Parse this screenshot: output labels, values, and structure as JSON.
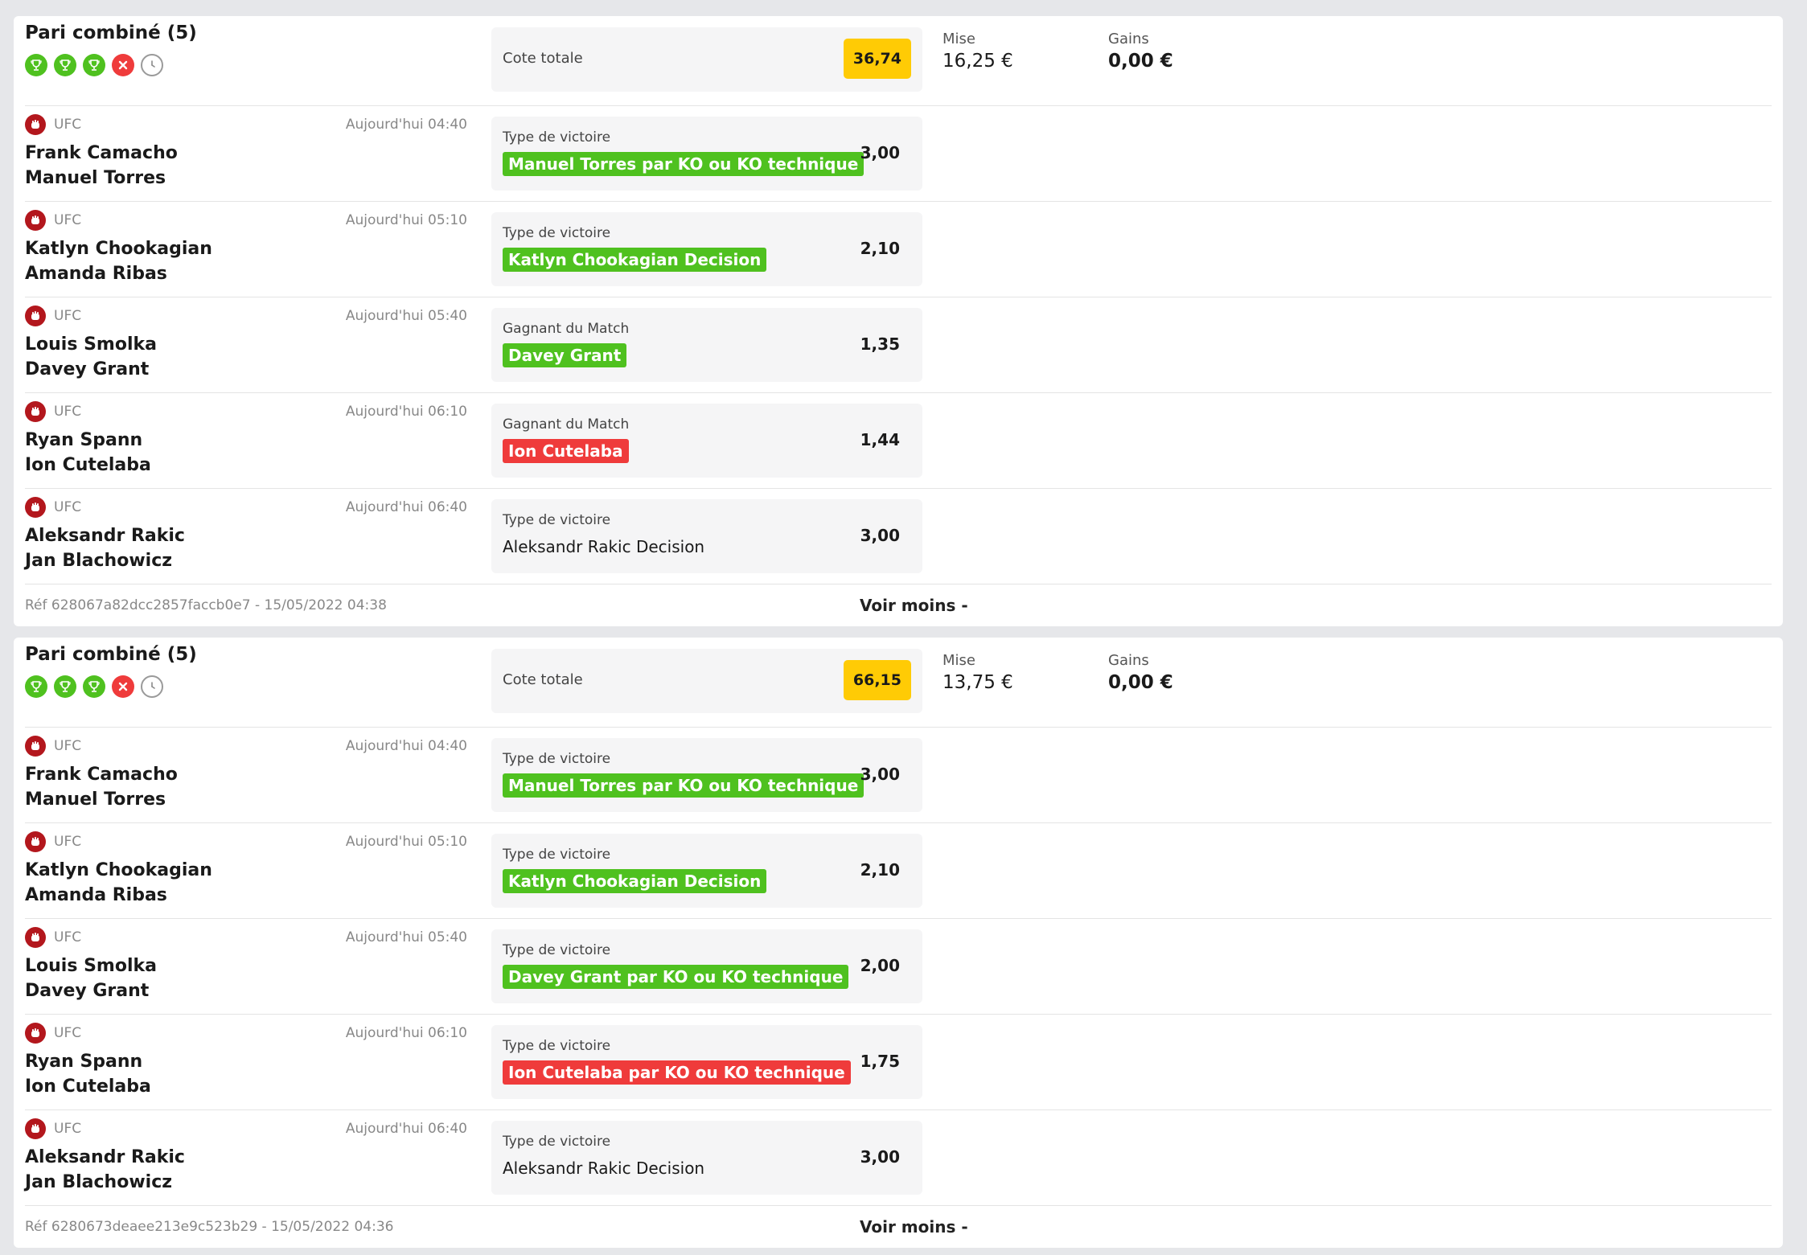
{
  "colors": {
    "won": "#4fc11f",
    "lost": "#ef3b3b",
    "badge": "#ffcb05",
    "ufc": "#b3171d"
  },
  "bets": [
    {
      "title": "Pari combiné (5)",
      "statuses": [
        "won",
        "won",
        "won",
        "lost",
        "pending"
      ],
      "cote_label": "Cote totale",
      "cote_value": "36,74",
      "mise_label": "Mise",
      "mise_value": "16,25 €",
      "gains_label": "Gains",
      "gains_value": "0,00 €",
      "events": [
        {
          "sport": "UFC",
          "time": "Aujourd'hui 04:40",
          "team1": "Frank Camacho",
          "team2": "Manuel Torres",
          "market": "Type de victoire",
          "pick": "Manuel Torres par KO ou KO technique",
          "status": "won",
          "odd": "3,00"
        },
        {
          "sport": "UFC",
          "time": "Aujourd'hui 05:10",
          "team1": "Katlyn Chookagian",
          "team2": "Amanda Ribas",
          "market": "Type de victoire",
          "pick": "Katlyn Chookagian Decision",
          "status": "won",
          "odd": "2,10"
        },
        {
          "sport": "UFC",
          "time": "Aujourd'hui 05:40",
          "team1": "Louis Smolka",
          "team2": "Davey Grant",
          "market": "Gagnant du Match",
          "pick": "Davey Grant",
          "status": "won",
          "odd": "1,35"
        },
        {
          "sport": "UFC",
          "time": "Aujourd'hui 06:10",
          "team1": "Ryan Spann",
          "team2": "Ion Cutelaba",
          "market": "Gagnant du Match",
          "pick": "Ion Cutelaba",
          "status": "lost",
          "odd": "1,44"
        },
        {
          "sport": "UFC",
          "time": "Aujourd'hui 06:40",
          "team1": "Aleksandr Rakic",
          "team2": "Jan Blachowicz",
          "market": "Type de victoire",
          "pick": "Aleksandr Rakic Decision",
          "status": "pending",
          "odd": "3,00"
        }
      ],
      "ref": "Réf 628067a82dcc2857faccb0e7 - 15/05/2022 04:38",
      "toggle_label": "Voir moins -"
    },
    {
      "title": "Pari combiné (5)",
      "statuses": [
        "won",
        "won",
        "won",
        "lost",
        "pending"
      ],
      "cote_label": "Cote totale",
      "cote_value": "66,15",
      "mise_label": "Mise",
      "mise_value": "13,75 €",
      "gains_label": "Gains",
      "gains_value": "0,00 €",
      "events": [
        {
          "sport": "UFC",
          "time": "Aujourd'hui 04:40",
          "team1": "Frank Camacho",
          "team2": "Manuel Torres",
          "market": "Type de victoire",
          "pick": "Manuel Torres par KO ou KO technique",
          "status": "won",
          "odd": "3,00"
        },
        {
          "sport": "UFC",
          "time": "Aujourd'hui 05:10",
          "team1": "Katlyn Chookagian",
          "team2": "Amanda Ribas",
          "market": "Type de victoire",
          "pick": "Katlyn Chookagian Decision",
          "status": "won",
          "odd": "2,10"
        },
        {
          "sport": "UFC",
          "time": "Aujourd'hui 05:40",
          "team1": "Louis Smolka",
          "team2": "Davey Grant",
          "market": "Type de victoire",
          "pick": "Davey Grant par KO ou KO technique",
          "status": "won",
          "odd": "2,00"
        },
        {
          "sport": "UFC",
          "time": "Aujourd'hui 06:10",
          "team1": "Ryan Spann",
          "team2": "Ion Cutelaba",
          "market": "Type de victoire",
          "pick": "Ion Cutelaba par KO ou KO technique",
          "status": "lost",
          "odd": "1,75"
        },
        {
          "sport": "UFC",
          "time": "Aujourd'hui 06:40",
          "team1": "Aleksandr Rakic",
          "team2": "Jan Blachowicz",
          "market": "Type de victoire",
          "pick": "Aleksandr Rakic Decision",
          "status": "pending",
          "odd": "3,00"
        }
      ],
      "ref": "Réf 6280673deaee213e9c523b29 - 15/05/2022 04:36",
      "toggle_label": "Voir moins -"
    }
  ]
}
